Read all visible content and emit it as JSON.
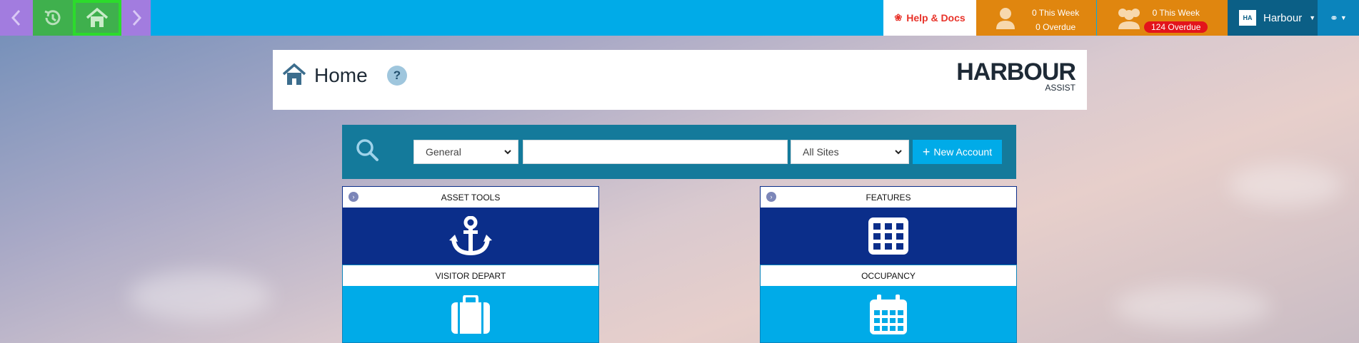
{
  "nav": {
    "back_icon": "chevron-left-icon",
    "history_icon": "history-icon",
    "home_icon": "home-icon",
    "forward_icon": "chevron-right-icon"
  },
  "topbar": {
    "help_label": "Help & Docs",
    "my_tasks": {
      "this_week": "0 This Week",
      "overdue": "0 Overdue"
    },
    "team_tasks": {
      "this_week": "0 This Week",
      "overdue": "124 Overdue"
    },
    "account_logo": "HA",
    "account_name": "Harbour",
    "colors": {
      "bar": "#00abe8",
      "tasks": "#e0860f",
      "overdue_badge": "#e3141b",
      "account": "#0b5f86"
    }
  },
  "header": {
    "title": "Home",
    "help_symbol": "?",
    "brand_main": "HARBOUR",
    "brand_sub": "ASSIST"
  },
  "search": {
    "type_value": "General",
    "query_value": "",
    "site_value": "All Sites",
    "new_account_label": "New Account"
  },
  "tiles": [
    {
      "label": "ASSET TOOLS",
      "icon": "anchor-icon",
      "style": "dark"
    },
    {
      "label": "FEATURES",
      "icon": "grid-icon",
      "style": "dark"
    },
    {
      "label": "VISITOR DEPART",
      "icon": "suitcase-icon",
      "style": "light"
    },
    {
      "label": "OCCUPANCY",
      "icon": "calendar-icon",
      "style": "light"
    }
  ]
}
